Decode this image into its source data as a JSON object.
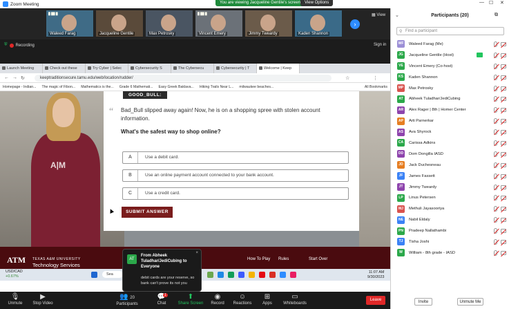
{
  "window": {
    "title": "Zoom Meeting"
  },
  "share_banner": "You are viewing Jacqueline Gentile's screen",
  "view_options": "View Options",
  "gallery": {
    "tiles": [
      {
        "name": "Waleed Farag",
        "bg": "#3f6b86"
      },
      {
        "name": "Jacqueline Gentile",
        "bg": "#5a4a3a"
      },
      {
        "name": "Max Petrosky",
        "bg": "#4a5562"
      },
      {
        "name": "Vincent Emery",
        "bg": "#6b7178"
      },
      {
        "name": "Jimmy Tweardy",
        "bg": "#6b5b4a"
      },
      {
        "name": "Kaden Shannon",
        "bg": "#3a6a88"
      }
    ],
    "view_label": "View",
    "next_label": "›"
  },
  "recording": "Recording",
  "sign_in": "Sign in",
  "browser": {
    "tabs": [
      "Launch Meeting",
      "Check out these",
      "Try Cyber | Selec",
      "Cybersecurity S",
      "The Cybersecu",
      "Cybersecurity | T",
      "Welcome | Keep"
    ],
    "url": "keeptraditionsecure.tamu.edu/web/location/rudder/",
    "bookmarks": [
      "Homepage - Indian...",
      "The magic of Fibon...",
      "Mathematics is the...",
      "Grade 6 Mathemati...",
      "Easy Greek Baklava...",
      "Hiking Trails Near L...",
      "milwaukee beaches...",
      "All Bookmarks"
    ]
  },
  "quiz": {
    "speaker": "GOOD_BULL:",
    "quote_mark": "“",
    "story": "Bad_Bull slipped away again! Now, he is on a shopping spree with stolen account information.",
    "question": "What's the safest way to shop online?",
    "options": [
      {
        "letter": "A",
        "text": "Use a debit card."
      },
      {
        "letter": "B",
        "text": "Use an online payment account connected to your bank account."
      },
      {
        "letter": "C",
        "text": "Use a credit card."
      }
    ],
    "submit": "SUBMIT ANSWER",
    "shirt_text": "A|M"
  },
  "site_footer": {
    "logo": "ATM",
    "university": "TEXAS A&M UNIVERSITY",
    "unit": "Technology Services",
    "links": [
      "How To Play",
      "Rules",
      "Start Over"
    ]
  },
  "taskbar": {
    "ticker": "USD/CAD",
    "change": "+0.67%",
    "search": "Sea",
    "time": "11:07 AM",
    "date": "9/30/2023"
  },
  "chat_popup": {
    "avatar": "AT",
    "from": "From Abheek Tuladhar/JediCubing to Everyone",
    "message": "debit cards are your reserve, so bank can't prove its not you",
    "close": "×"
  },
  "toolbar": {
    "unmute": "Unmute",
    "stop_video": "Stop Video",
    "participants": "Participants",
    "participants_count": "20",
    "chat": "Chat",
    "chat_badge": "1",
    "share_screen": "Share Screen",
    "record": "Record",
    "reactions": "Reactions",
    "apps": "Apps",
    "whiteboards": "Whiteboards",
    "leave": "Leave"
  },
  "panel": {
    "title": "Participants (20)",
    "search_placeholder": "Find a participant",
    "invite": "Invite",
    "unmute_me": "Unmute Me",
    "participants": [
      {
        "initials": "WF",
        "name": "Waleed Farag (Me)",
        "color": "#9c8fd6",
        "sharing": false
      },
      {
        "initials": "JG",
        "name": "Jacqueline Gentile (Host)",
        "color": "#2ba84a",
        "sharing": true
      },
      {
        "initials": "VE",
        "name": "Vincent Emery (Co-host)",
        "color": "#2ba84a",
        "sharing": false
      },
      {
        "initials": "KS",
        "name": "Kaden Shannon",
        "color": "#2ba84a",
        "sharing": false
      },
      {
        "initials": "MP",
        "name": "Max Petrosky",
        "color": "#d9534f",
        "sharing": false
      },
      {
        "initials": "AT",
        "name": "Abheek Tuladhar/JediCubing",
        "color": "#2ba84a",
        "sharing": false
      },
      {
        "initials": "AR",
        "name": "Alex Rager | 8th | Homer Center",
        "color": "#8e44ad",
        "sharing": false
      },
      {
        "initials": "AP",
        "name": "Arti Parnerkar",
        "color": "#e67e22",
        "sharing": false
      },
      {
        "initials": "AS",
        "name": "Ava Shyrock",
        "color": "#8e44ad",
        "sharing": false
      },
      {
        "initials": "CA",
        "name": "Carissa Adkins",
        "color": "#2ba84a",
        "sharing": false
      },
      {
        "initials": "DD",
        "name": "Dom Dongilla IASD",
        "color": "#8e44ad",
        "sharing": false
      },
      {
        "initials": "JD",
        "name": "Jack Duchesneau",
        "color": "#e67e22",
        "sharing": false
      },
      {
        "initials": "JF",
        "name": "James Fassett",
        "color": "#3b82f6",
        "sharing": false
      },
      {
        "initials": "JT",
        "name": "Jimmy Tweardy",
        "color": "#8e44ad",
        "sharing": false
      },
      {
        "initials": "LP",
        "name": "Linus Petersen",
        "color": "#2ba84a",
        "sharing": false
      },
      {
        "initials": "MJ",
        "name": "Methuli Jayasooriya",
        "color": "#d9534f",
        "sharing": false
      },
      {
        "initials": "NE",
        "name": "Nabil Eldaly",
        "color": "#3b82f6",
        "sharing": false
      },
      {
        "initials": "PN",
        "name": "Pradeep Nallathambi",
        "color": "#2ba84a",
        "sharing": false
      },
      {
        "initials": "TJ",
        "name": "Tisha Joshi",
        "color": "#3b82f6",
        "sharing": false
      },
      {
        "initials": "W",
        "name": "William - 8th grade - IASD",
        "color": "#2ba84a",
        "sharing": false
      }
    ]
  }
}
